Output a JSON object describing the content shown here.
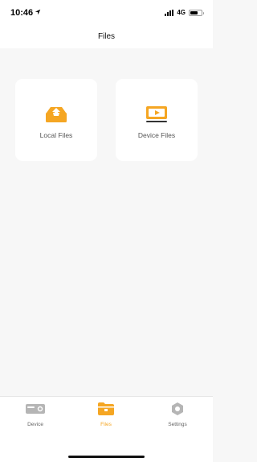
{
  "status_bar": {
    "time": "10:46",
    "network": "4G",
    "location_icon": "location-arrow-icon",
    "signal_icon": "signal-bars-icon",
    "battery_icon": "battery-icon"
  },
  "nav": {
    "title": "Files"
  },
  "cards": [
    {
      "label": "Local Files",
      "icon": "local-files-icon"
    },
    {
      "label": "Device Files",
      "icon": "device-files-icon"
    }
  ],
  "tabs": [
    {
      "label": "Device",
      "icon": "camera-device-icon",
      "active": false
    },
    {
      "label": "Files",
      "icon": "folder-icon",
      "active": true
    },
    {
      "label": "Settings",
      "icon": "hexagon-gear-icon",
      "active": false
    }
  ],
  "colors": {
    "accent": "#f5a623",
    "background": "#f7f7f7",
    "card": "#ffffff",
    "inactive_icon": "#b5b5b5"
  }
}
